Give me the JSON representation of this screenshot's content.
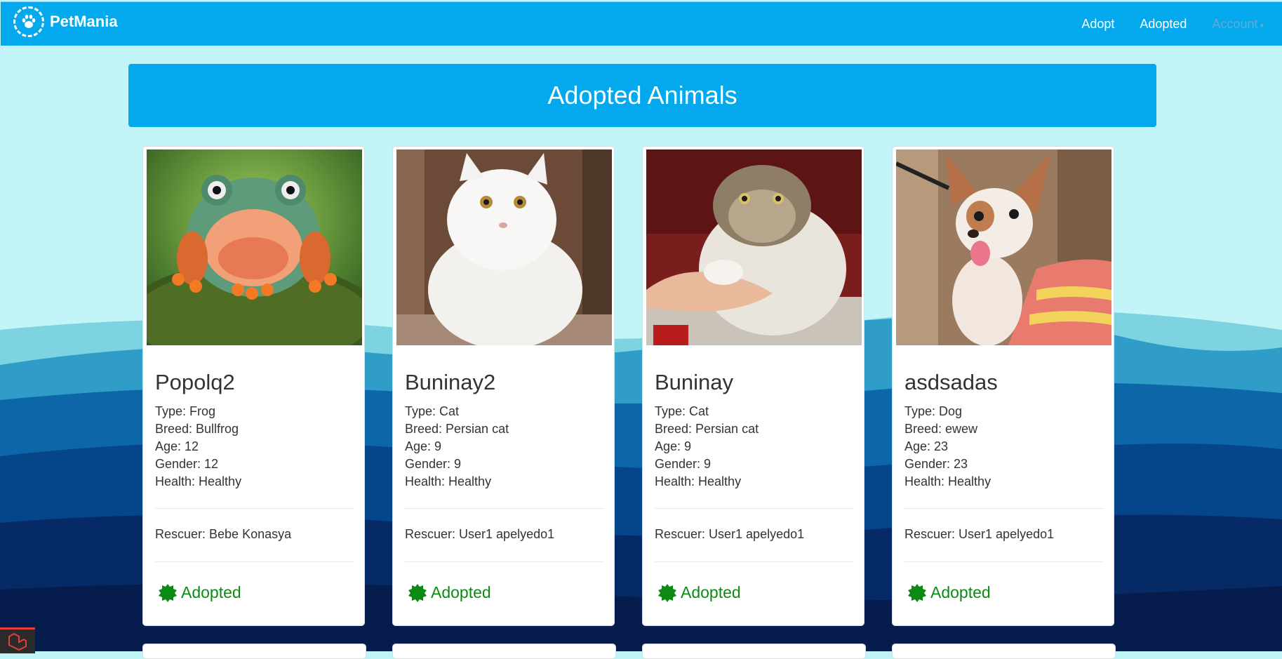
{
  "navbar": {
    "brand": "PetMania",
    "links": [
      "Adopt",
      "Adopted"
    ],
    "account": "Account"
  },
  "hero": {
    "title": "Adopted Animals"
  },
  "cards": [
    {
      "name": "Popolq2",
      "type": "Type: Frog",
      "breed": "Breed: Bullfrog",
      "age": "Age: 12",
      "gender": "Gender: 12",
      "health": "Health: Healthy",
      "rescuer": "Rescuer: Bebe Konasya",
      "status": "Adopted"
    },
    {
      "name": "Buninay2",
      "type": "Type: Cat",
      "breed": "Breed: Persian cat",
      "age": "Age: 9",
      "gender": "Gender: 9",
      "health": "Health: Healthy",
      "rescuer": "Rescuer: User1 apelyedo1",
      "status": "Adopted"
    },
    {
      "name": "Buninay",
      "type": "Type: Cat",
      "breed": "Breed: Persian cat",
      "age": "Age: 9",
      "gender": "Gender: 9",
      "health": "Health: Healthy",
      "rescuer": "Rescuer: User1 apelyedo1",
      "status": "Adopted"
    },
    {
      "name": "asdsadas",
      "type": "Type: Dog",
      "breed": "Breed: ewew",
      "age": "Age: 23",
      "gender": "Gender: 23",
      "health": "Health: Healthy",
      "rescuer": "Rescuer: User1 apelyedo1",
      "status": "Adopted"
    }
  ],
  "colors": {
    "navbar": "#03a9ec",
    "adopted_status": "#0d8a15",
    "background_sky": "#bff3f6"
  }
}
